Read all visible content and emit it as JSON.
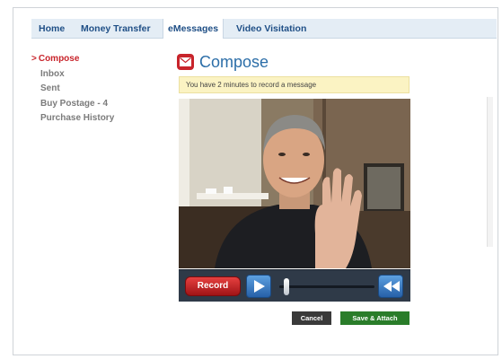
{
  "nav": {
    "tabs": [
      {
        "label": "Home"
      },
      {
        "label": "Money Transfer"
      },
      {
        "label": "eMessages"
      },
      {
        "label": "Video Visitation"
      }
    ],
    "active_index": 2
  },
  "sidebar": {
    "caret": ">",
    "items": [
      {
        "label": "Compose"
      },
      {
        "label": "Inbox"
      },
      {
        "label": "Sent"
      },
      {
        "label": "Buy Postage - 4"
      },
      {
        "label": "Purchase History"
      }
    ],
    "active_index": 0
  },
  "page": {
    "title": "Compose",
    "title_icon": "envelope-icon",
    "notice": "You have 2 minutes to record a message"
  },
  "player": {
    "record_label": "Record",
    "play_icon": "play-icon",
    "rewind_icon": "rewind-icon",
    "scrubber_position": 0.08
  },
  "actions": {
    "cancel_label": "Cancel",
    "save_label": "Save & Attach"
  },
  "colors": {
    "accent_red": "#c8242b",
    "link_blue": "#1f4f86",
    "title_blue": "#2c6ea8",
    "notice_bg": "#fbf3c3",
    "save_green": "#2a7d2a"
  }
}
